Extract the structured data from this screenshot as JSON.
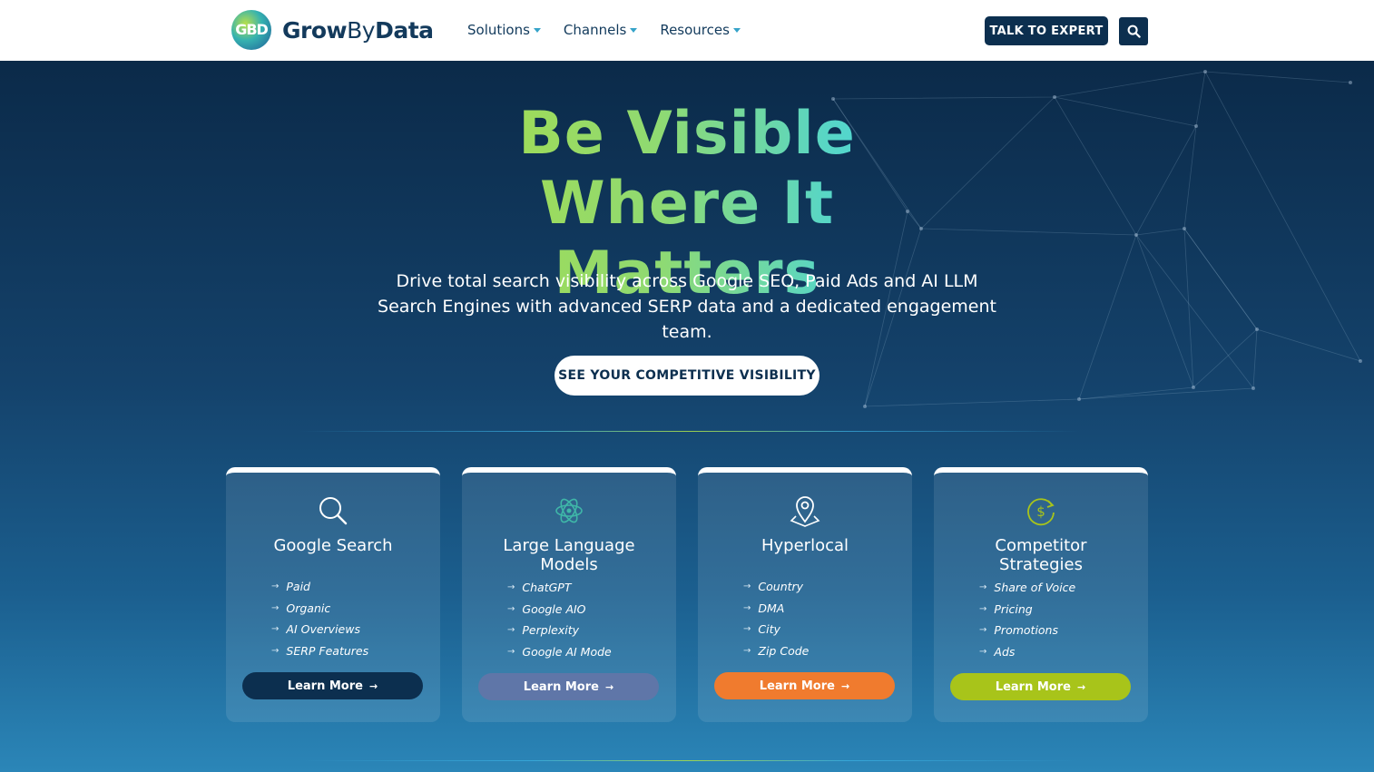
{
  "header": {
    "logo_mark": "GBD",
    "logo_word1": "Grow",
    "logo_word2": "By",
    "logo_word3": "Data",
    "nav": [
      {
        "label": "Solutions"
      },
      {
        "label": "Channels"
      },
      {
        "label": "Resources"
      }
    ],
    "cta_label": "TALK TO EXPERT",
    "search_icon": "search-icon"
  },
  "hero": {
    "title": "Be Visible Where It Matters",
    "subtitle": "Drive total search visibility across Google SEO, Paid Ads and AI LLM Search Engines with advanced SERP data and a dedicated engagement team.",
    "cta_label": "SEE YOUR COMPETITIVE VISIBILITY"
  },
  "cards": [
    {
      "title": "Google Search",
      "icon": "magnifier-icon",
      "items": [
        "Paid",
        "Organic",
        "AI Overviews",
        "SERP Features"
      ],
      "button_label": "Learn More",
      "button_color": "#0c2f4f"
    },
    {
      "title": "Large Language Models",
      "icon": "atom-icon",
      "items": [
        "ChatGPT",
        "Google AIO",
        "Perplexity",
        "Google AI Mode"
      ],
      "button_label": "Learn More",
      "button_color": "#5f76a8"
    },
    {
      "title": "Hyperlocal",
      "icon": "location-pin-icon",
      "items": [
        "Country",
        "DMA",
        "City",
        "Zip Code"
      ],
      "button_label": "Learn More",
      "button_color": "#f07b2e"
    },
    {
      "title": "Competitor Strategies",
      "icon": "dollar-refresh-icon",
      "items": [
        "Share of Voice",
        "Pricing",
        "Promotions",
        "Ads"
      ],
      "button_label": "Learn More",
      "button_color": "#a8c41a"
    }
  ],
  "colors": {
    "brand_navy": "#0c2f4f",
    "accent_green": "#a8dc4a",
    "accent_cyan": "#3cd3ee",
    "nav_caret": "#36a3c9"
  }
}
